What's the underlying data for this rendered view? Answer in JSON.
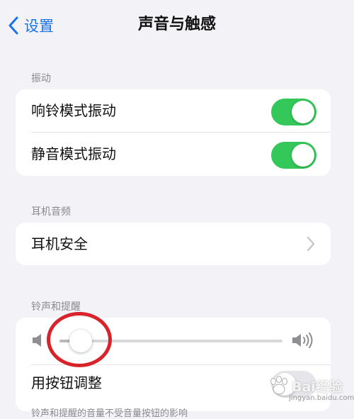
{
  "nav": {
    "back_label": "设置",
    "title": "声音与触感"
  },
  "sections": {
    "vibration": {
      "header": "振动",
      "rows": [
        {
          "label": "响铃模式振动",
          "toggle": "on"
        },
        {
          "label": "静音模式振动",
          "toggle": "on"
        }
      ]
    },
    "headphone_audio": {
      "header": "耳机音频",
      "rows": [
        {
          "label": "耳机安全"
        }
      ]
    },
    "ringtone_alerts": {
      "header": "铃声和提醒",
      "volume_level": 0.05,
      "adjust_with_buttons": {
        "label": "用按钮调整",
        "toggle": "off"
      }
    }
  },
  "footer_text": "铃声和提醒的音量不受音量按钮的影响",
  "watermark": {
    "text": "Bai经验",
    "sub": "jingyan.baidu.com"
  },
  "colors": {
    "accent": "#1a73e8",
    "toggle_on": "#34c759",
    "annotation": "#d8232a",
    "background": "#f2f2f7"
  }
}
